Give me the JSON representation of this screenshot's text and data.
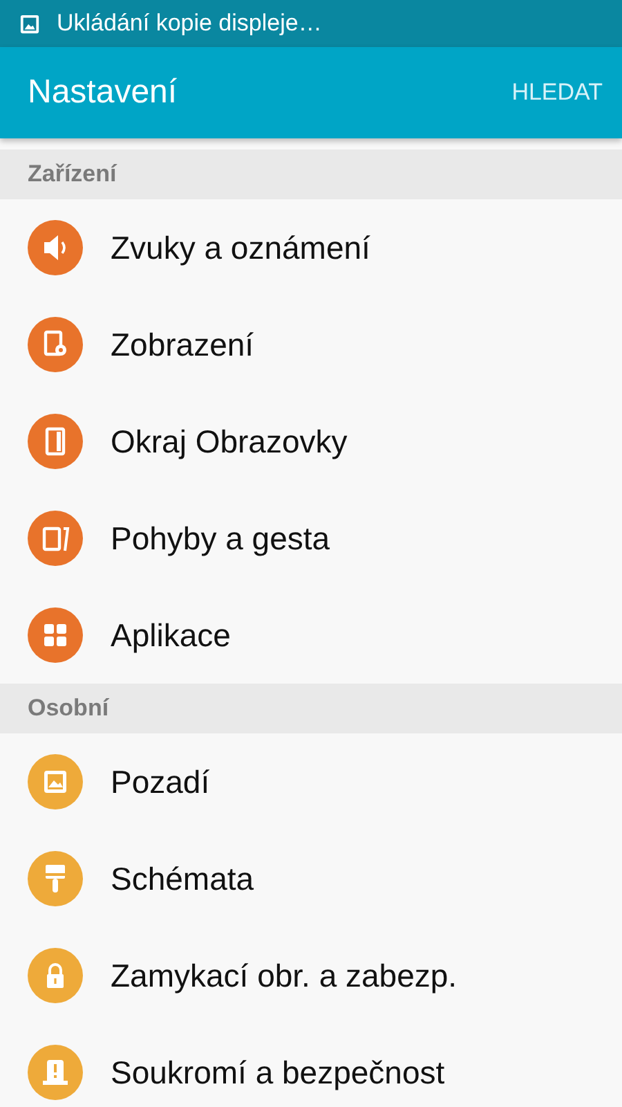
{
  "status_bar": {
    "notification": "Ukládání kopie displeje…"
  },
  "app_bar": {
    "title": "Nastavení",
    "action": "HLEDAT"
  },
  "sections": [
    {
      "title": "Zařízení",
      "items": [
        {
          "label": "Zvuky a oznámení",
          "color": "#e8732b"
        },
        {
          "label": "Zobrazení",
          "color": "#e8732b"
        },
        {
          "label": "Okraj Obrazovky",
          "color": "#e8732b"
        },
        {
          "label": "Pohyby a gesta",
          "color": "#e8732b"
        },
        {
          "label": "Aplikace",
          "color": "#e8732b"
        }
      ]
    },
    {
      "title": "Osobní",
      "items": [
        {
          "label": "Pozadí",
          "color": "#eeaa3a"
        },
        {
          "label": "Schémata",
          "color": "#eeaa3a"
        },
        {
          "label": "Zamykací obr. a zabezp.",
          "color": "#eeaa3a"
        },
        {
          "label": "Soukromí a bezpečnost",
          "color": "#eeaa3a"
        }
      ]
    }
  ]
}
